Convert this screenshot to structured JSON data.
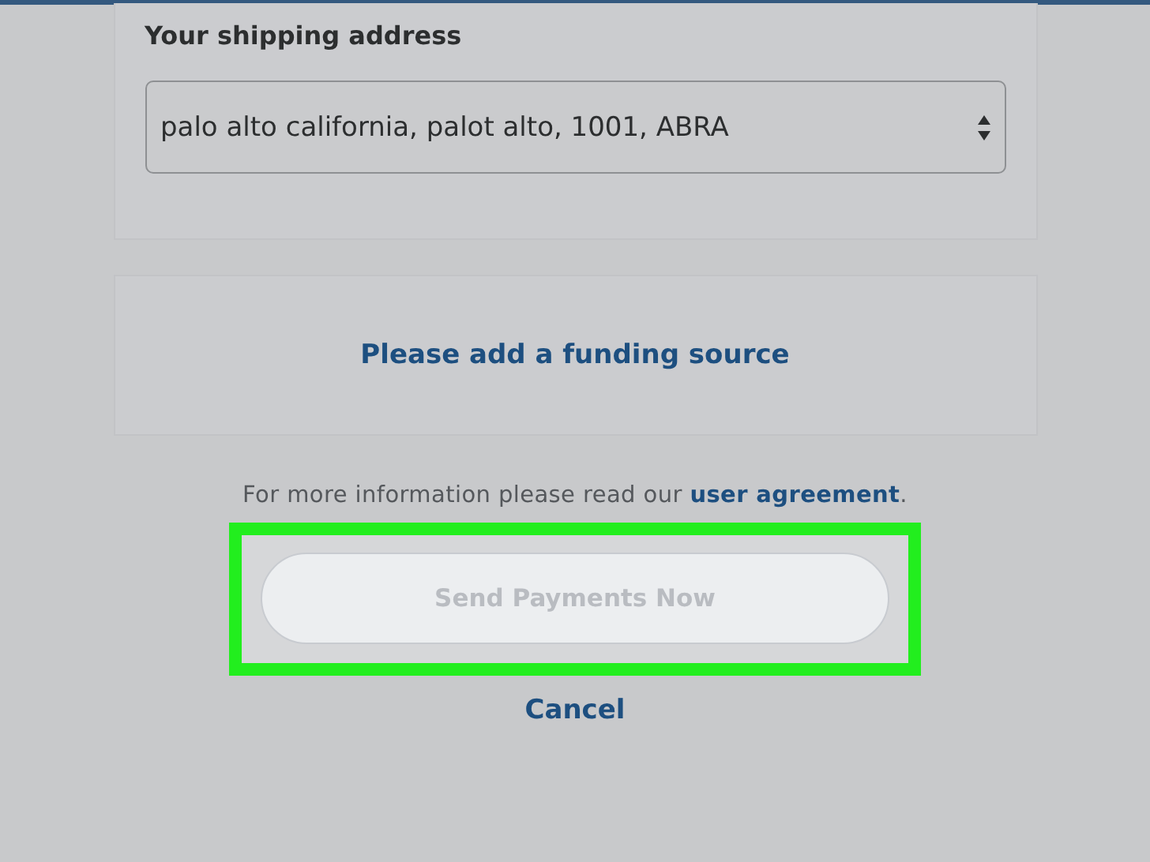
{
  "shipping": {
    "label": "Your shipping address",
    "value": "palo alto california, palot alto, 1001, ABRA"
  },
  "funding": {
    "link": "Please add a funding source"
  },
  "info": {
    "text": "For more information please read our ",
    "link": "user agreement",
    "end": "."
  },
  "send_button": {
    "label": "Send Payments Now",
    "disabled": true,
    "highlighted": true
  },
  "cancel": {
    "label": "Cancel"
  }
}
